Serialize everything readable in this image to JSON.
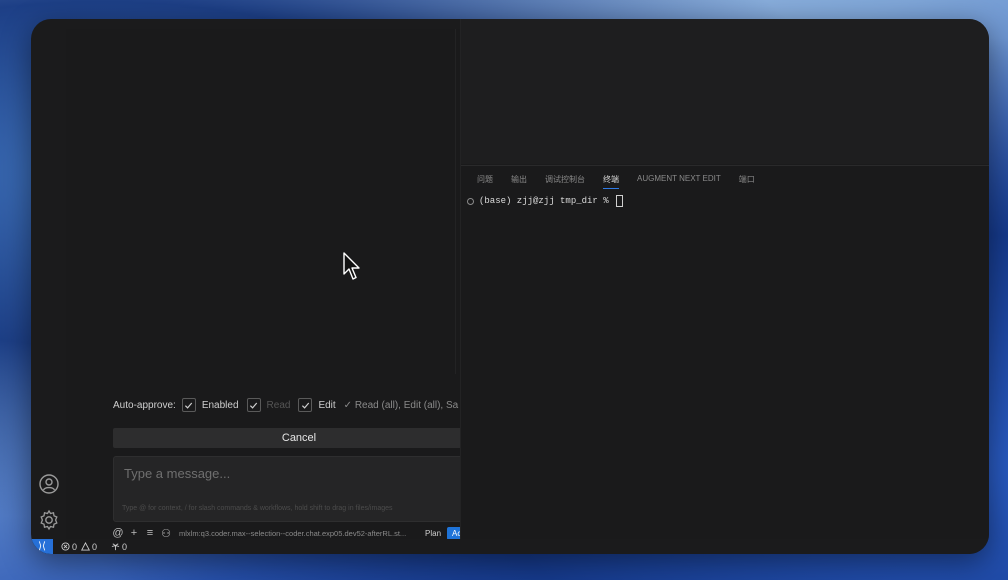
{
  "chat": {
    "auto_approve": {
      "label": "Auto-approve:",
      "options": [
        {
          "label": "Enabled",
          "checked": true
        },
        {
          "label": "Read",
          "checked": true
        },
        {
          "label": "Edit",
          "checked": true
        }
      ],
      "summary": "✓ Read (all), Edit (all), Sa"
    },
    "cancel_label": "Cancel",
    "input": {
      "placeholder": "Type a message...",
      "value": "",
      "hint": "Type @ for context, / for slash commands & workflows, hold shift to drag in files/images"
    },
    "model": "mlxlm:q3.coder.max--selection--coder.chat.exp05.dev52-afterRL.st...",
    "mode_plan": "Plan",
    "mode_act": "Act"
  },
  "panel": {
    "tabs": [
      {
        "label": "问题",
        "active": false
      },
      {
        "label": "输出",
        "active": false
      },
      {
        "label": "调试控制台",
        "active": false
      },
      {
        "label": "终端",
        "active": true
      },
      {
        "label": "AUGMENT NEXT EDIT",
        "active": false
      },
      {
        "label": "端口",
        "active": false
      }
    ],
    "terminal_prompt": "(base) zjj@zjj tmp_dir % "
  },
  "status": {
    "errors": "0",
    "warnings": "0",
    "ports": "0"
  },
  "colors": {
    "accent": "#1e73d8",
    "window_bg": "#1b1b1c"
  }
}
